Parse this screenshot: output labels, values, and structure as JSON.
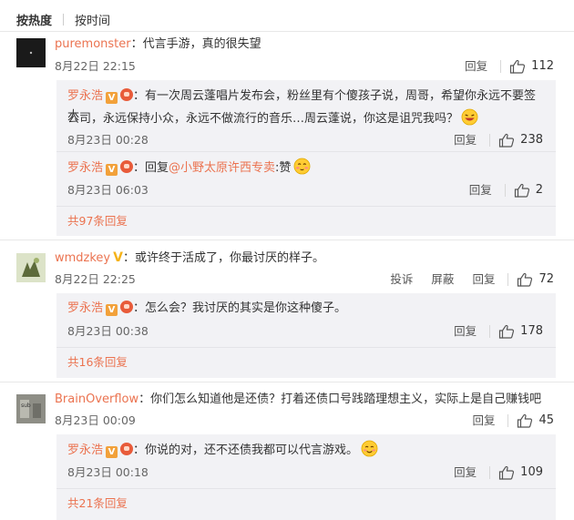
{
  "sort": {
    "active": "按热度",
    "other": "按时间"
  },
  "colors": {
    "username": "#eb7350",
    "reply_bg": "#f2f2f5",
    "verified_badge": "#f2a13a"
  },
  "threads": [
    {
      "user": "puremonster",
      "text": "：代言手游，真的很失望",
      "time": "8月22日 22:15",
      "reply_label": "回复",
      "likes": "112",
      "replies": [
        {
          "user": "罗永浩",
          "line1": "：有一次周云蓬唱片发布会，粉丝里有个傻孩子说，周哥，希望你永远不要签大",
          "line2": "公司，永远保持小众，永远不做流行的音乐…周云蓬说，你这是诅咒我吗？",
          "emoji": "laugh-emoji",
          "time": "8月23日 00:28",
          "reply_label": "回复",
          "likes": "238"
        },
        {
          "user": "罗永浩",
          "prefix": "：回复",
          "mention": "@小野太原许西专卖",
          "suffix": ":赞",
          "emoji": "shy-emoji",
          "time": "8月23日 06:03",
          "reply_label": "回复",
          "likes": "2"
        }
      ],
      "more": "共97条回复"
    },
    {
      "user": "wmdzkey",
      "text": "：或许终于活成了，你最讨厌的样子。",
      "time": "8月22日 22:25",
      "report_label": "投诉",
      "block_label": "屏蔽",
      "reply_label": "回复",
      "likes": "72",
      "replies": [
        {
          "user": "罗永浩",
          "line1": "：怎么会？我讨厌的其实是你这种傻子。",
          "time": "8月23日 00:38",
          "reply_label": "回复",
          "likes": "178"
        }
      ],
      "more": "共16条回复"
    },
    {
      "user": "BrainOverflow",
      "text": "：你们怎么知道他是还债？打着还债口号践踏理想主义，实际上是自己赚钱吧",
      "time": "8月23日 00:09",
      "reply_label": "回复",
      "likes": "45",
      "replies": [
        {
          "user": "罗永浩",
          "line1": "：你说的对，还不还债我都可以代言游戏。",
          "emoji": "smile-emoji",
          "time": "8月23日 00:18",
          "reply_label": "回复",
          "likes": "109"
        }
      ],
      "more": "共21条回复"
    }
  ]
}
